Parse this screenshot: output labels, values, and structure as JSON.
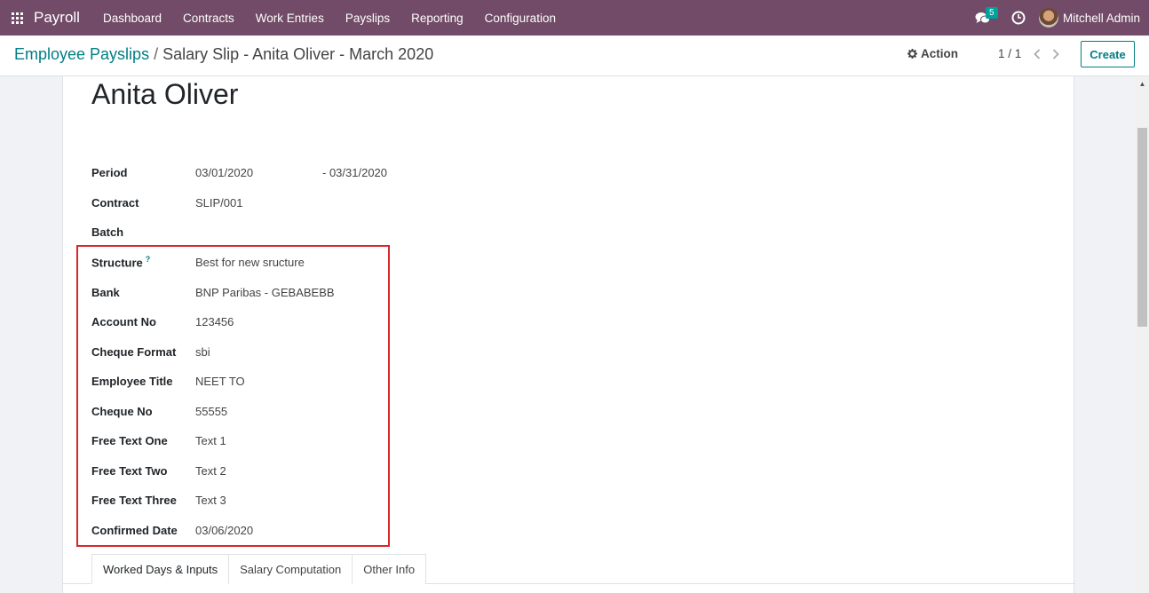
{
  "navbar": {
    "brand": "Payroll",
    "menu": [
      "Dashboard",
      "Contracts",
      "Work Entries",
      "Payslips",
      "Reporting",
      "Configuration"
    ],
    "message_count": "5",
    "user_name": "Mitchell Admin",
    "bg_color": "#714b67"
  },
  "control": {
    "breadcrumb_parent": "Employee Payslips",
    "breadcrumb_separator": "/",
    "breadcrumb_current": "Salary Slip - Anita Oliver - March 2020",
    "action_label": "Action",
    "pager": "1 / 1",
    "create_label": "Create"
  },
  "form": {
    "employee_name": "Anita Oliver",
    "period_label": "Period",
    "period_start": "03/01/2020",
    "period_end": "- 03/31/2020",
    "contract_label": "Contract",
    "contract_value": "SLIP/001",
    "batch_label": "Batch",
    "batch_value": "",
    "structure_label": "Structure",
    "structure_help": "?",
    "structure_value": "Best for new sructure",
    "bank_label": "Bank",
    "bank_value": "BNP Paribas - GEBABEBB",
    "account_label": "Account No",
    "account_value": "123456",
    "cheque_format_label": "Cheque Format",
    "cheque_format_value": "sbi",
    "employee_title_label": "Employee Title",
    "employee_title_value": "NEET TO",
    "cheque_no_label": "Cheque No",
    "cheque_no_value": "55555",
    "free_text_one_label": "Free Text One",
    "free_text_one_value": "Text 1",
    "free_text_two_label": "Free Text Two",
    "free_text_two_value": "Text 2",
    "free_text_three_label": "Free Text Three",
    "free_text_three_value": "Text 3",
    "confirmed_date_label": "Confirmed Date",
    "confirmed_date_value": "03/06/2020"
  },
  "tabs": [
    "Worked Days & Inputs",
    "Salary Computation",
    "Other Info"
  ],
  "colors": {
    "accent": "#017e84",
    "highlight_border": "#d9262c"
  },
  "icons": [
    "apps-grid-icon",
    "chat-icon",
    "clock-icon",
    "gear-icon",
    "chevron-left-icon",
    "chevron-right-icon",
    "scroll-up-arrow-icon"
  ]
}
